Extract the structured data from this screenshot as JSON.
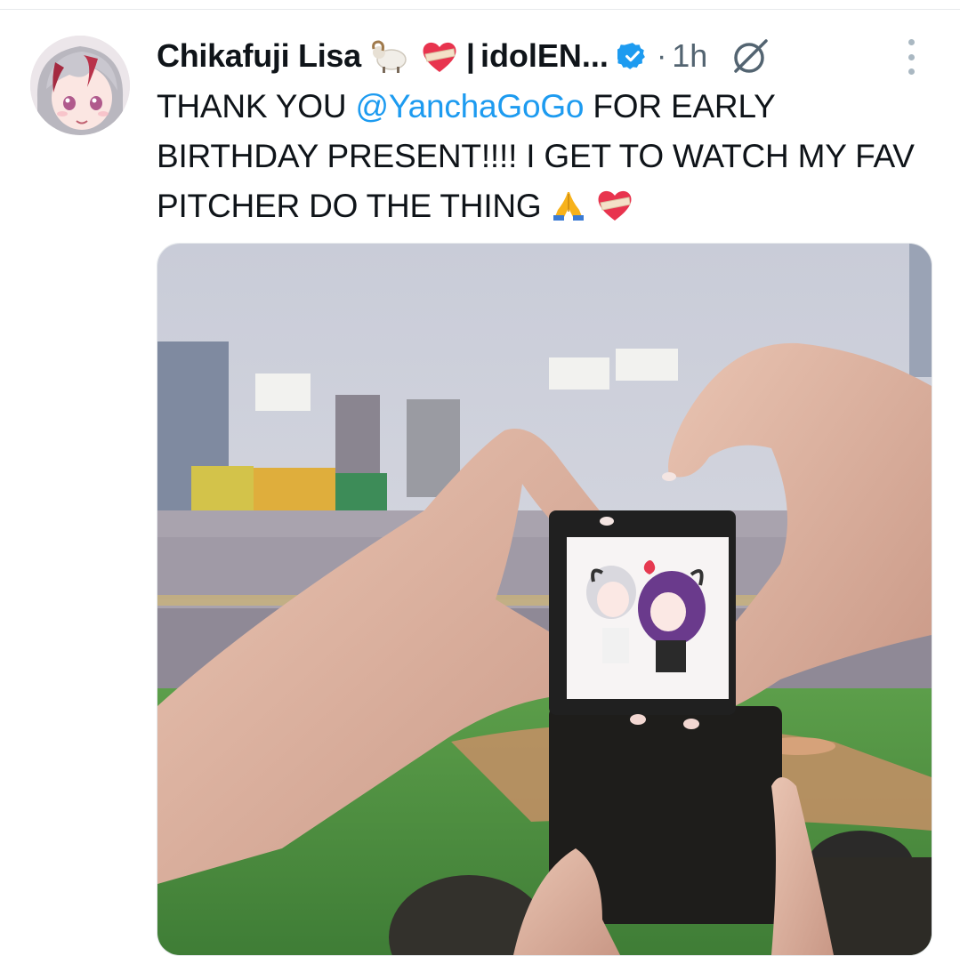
{
  "tweet": {
    "author": {
      "display_name": "Chikafuji Lisa",
      "name_suffix": "idolEN...",
      "separator": "|",
      "emojis": [
        "ram-emoji",
        "heart-bandage-emoji"
      ],
      "verified": true
    },
    "meta": {
      "dot": "·",
      "timestamp": "1h"
    },
    "text": {
      "part1": "THANK YOU ",
      "mention": "@YanchaGoGo",
      "part2": " FOR EARLY BIRTHDAY PRESENT!!!! I GET TO WATCH MY FAV PITCHER DO THE THING "
    },
    "text_emojis": [
      "folded-hands-emoji",
      "heart-bandage-emoji"
    ],
    "media": {
      "kind": "photo",
      "subject": "hands making heart shape around acrylic standee at baseball stadium"
    }
  },
  "icons": {
    "verified": "verified-badge-icon",
    "grok": "grok-icon",
    "more": "more-options-icon"
  },
  "colors": {
    "accent": "#1d9bf0",
    "text": "#0f1419",
    "secondary": "#536471"
  }
}
